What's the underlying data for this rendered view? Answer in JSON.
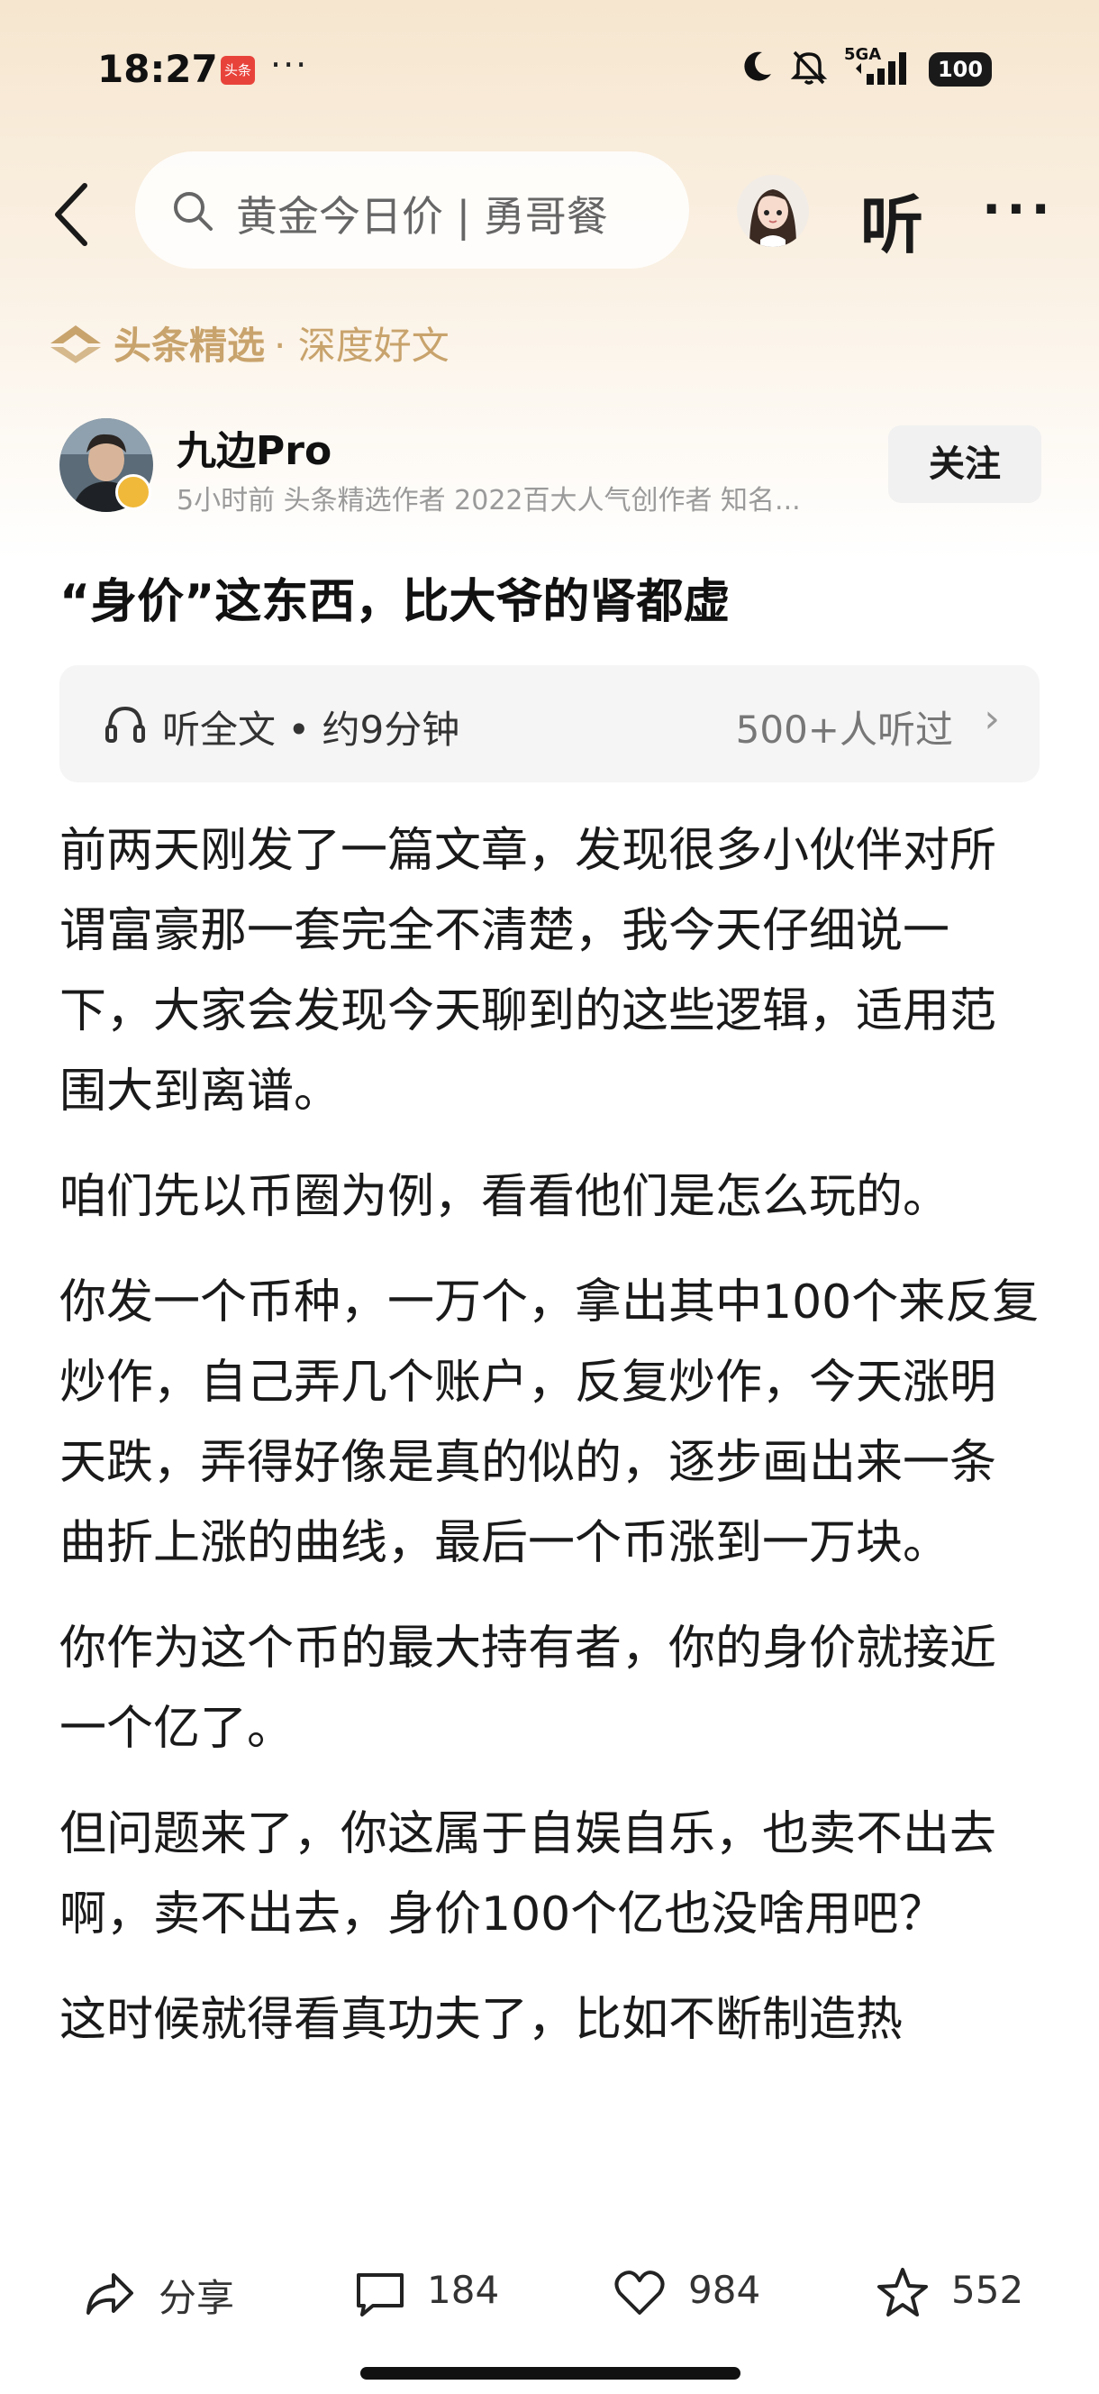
{
  "status_bar": {
    "time": "18:27",
    "app_badge": "头条",
    "more": "···",
    "network": "5GA",
    "battery": "100",
    "icons": [
      "moon-icon",
      "bell-off-icon",
      "signal-icon",
      "battery-icon"
    ]
  },
  "nav": {
    "search_text": "黄金今日价 | 勇哥餐",
    "listen_label": "听",
    "more_label": "···"
  },
  "channel": {
    "name": "头条精选",
    "sub": "· 深度好文"
  },
  "author": {
    "name": "九边Pro",
    "meta": "5小时前   头条精选作者 2022百大人气创作者 知名...",
    "follow_label": "关注"
  },
  "article": {
    "title": "“身价”这东西，比大爷的肾都虚",
    "audio_label": "听全文 • 约9分钟",
    "audio_count": "500+人听过",
    "audio_chevron": "›",
    "paragraphs": [
      "前两天刚发了一篇文章，发现很多小伙伴对所谓富豪那一套完全不清楚，我今天仔细说一下，大家会发现今天聊到的这些逻辑，适用范围大到离谱。",
      "咱们先以币圈为例，看看他们是怎么玩的。",
      "你发一个币种，一万个，拿出其中100个来反复炒作，自己弄几个账户，反复炒作，今天涨明天跌，弄得好像是真的似的，逐步画出来一条曲折上涨的曲线，最后一个币涨到一万块。",
      "你作为这个币的最大持有者，你的身价就接近一个亿了。",
      "但问题来了，你这属于自娱自乐，也卖不出去啊，卖不出去，身价100个亿也没啥用吧？",
      "这时候就得看真功夫了，比如不断制造热"
    ]
  },
  "bottom_bar": {
    "share_label": "分享",
    "comments": "184",
    "likes": "984",
    "favorites": "552"
  },
  "colors": {
    "accent_gold": "#c8a36c",
    "header_gradient_top": "#f6e6cf"
  }
}
